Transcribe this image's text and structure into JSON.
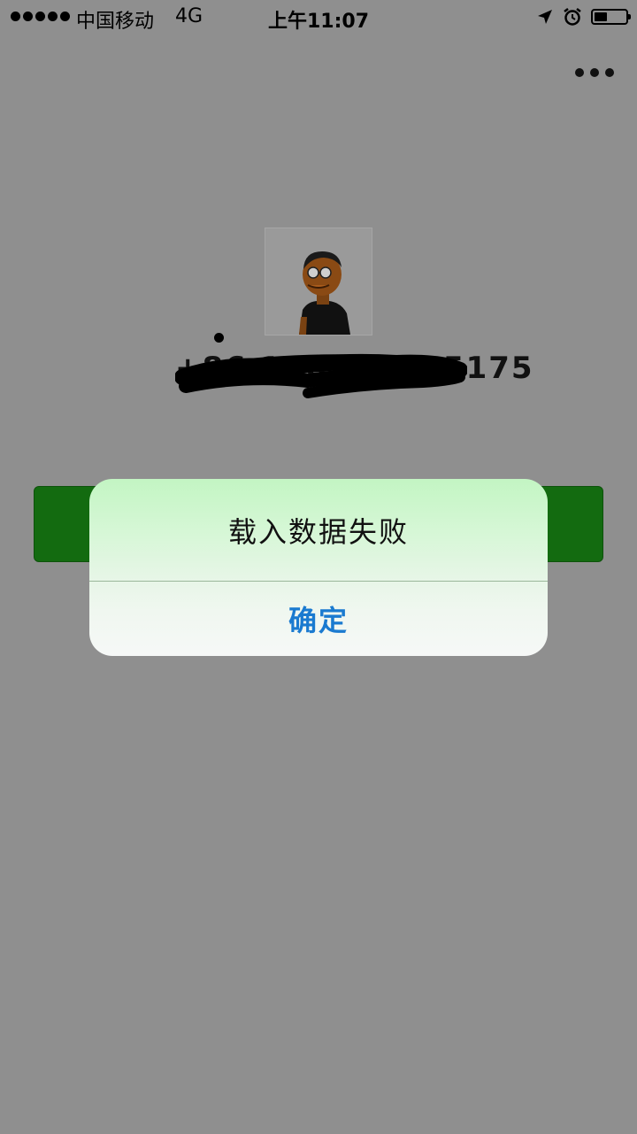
{
  "status_bar": {
    "carrier": "中国移动",
    "network": "4G",
    "time": "上午11:07"
  },
  "header": {
    "more_icon": "more-dots-icon"
  },
  "profile": {
    "phone_number": "+86 156 1326 5175"
  },
  "dialog": {
    "title": "载入数据失败",
    "confirm_label": "确定"
  },
  "colors": {
    "overlay_background": "#8f8f8f",
    "primary_button": "#136b10",
    "confirm_text": "#1a7ad0"
  }
}
